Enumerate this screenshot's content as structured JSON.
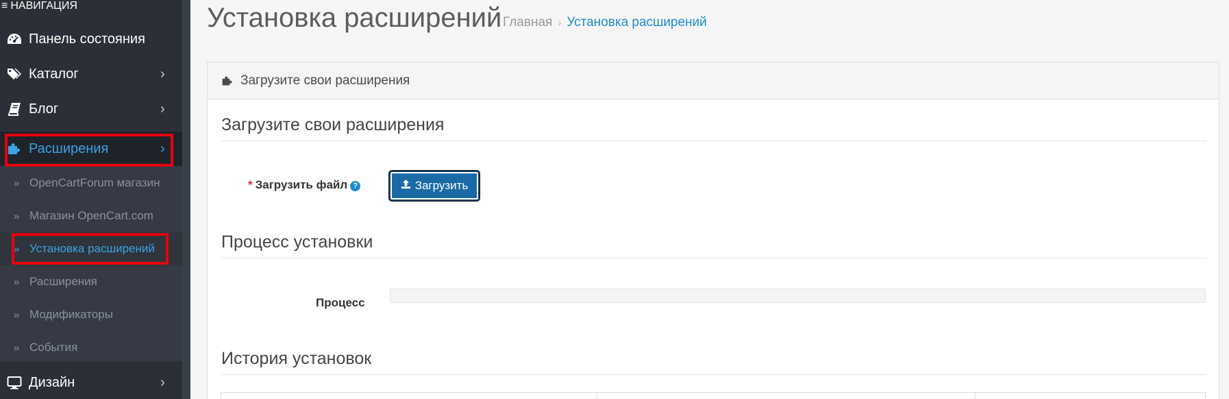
{
  "sidebar": {
    "heading": "НАВИГАЦИЯ",
    "items": [
      {
        "label": "Панель состояния",
        "icon": "dashboard-icon"
      },
      {
        "label": "Каталог",
        "icon": "tags-icon"
      },
      {
        "label": "Блог",
        "icon": "book-icon"
      },
      {
        "label": "Расширения",
        "icon": "puzzle-icon"
      },
      {
        "label": "Дизайн",
        "icon": "monitor-icon"
      }
    ],
    "submenu": [
      {
        "label": "OpenCartForum магазин"
      },
      {
        "label": "Магазин OpenCart.com"
      },
      {
        "label": "Установка расширений"
      },
      {
        "label": "Расширения"
      },
      {
        "label": "Модификаторы"
      },
      {
        "label": "События"
      }
    ]
  },
  "header": {
    "title": "Установка расширений",
    "breadcrumb": {
      "home": "Главная",
      "separator": "›",
      "current": "Установка расширений"
    }
  },
  "panel": {
    "heading": "Загрузите свои расширения",
    "upload_section": {
      "legend": "Загрузите свои расширения",
      "required_mark": "*",
      "file_label": "Загрузить файл",
      "help_symbol": "?",
      "button_label": "Загрузить"
    },
    "process_section": {
      "legend": "Процесс установки",
      "progress_label": "Процесс",
      "progress_value": 0
    },
    "history_section": {
      "legend": "История установок"
    }
  },
  "colors": {
    "sidebar_bg": "#2b2f37",
    "accent": "#1e8bd0",
    "highlight_box": "#e8000e",
    "button_bg": "#1a6aa5"
  }
}
